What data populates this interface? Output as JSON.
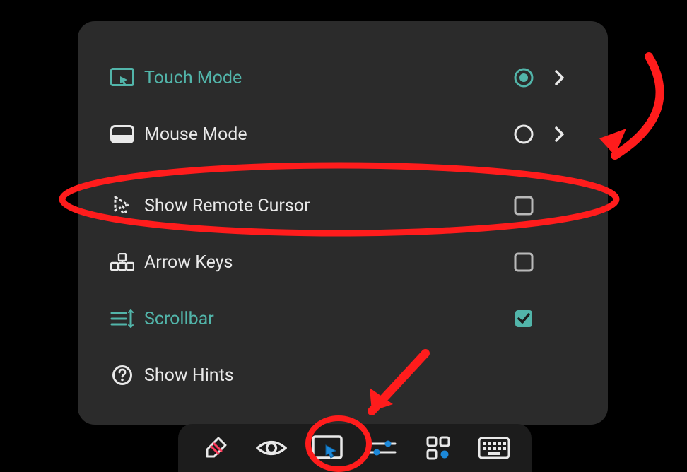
{
  "colors": {
    "accent": "#52b5aa",
    "panel": "#2b2b2b",
    "toolbar": "#1c1c1c",
    "fg": "#e9e9e9",
    "annotation": "#ff1c1c"
  },
  "menu": {
    "touch_mode": {
      "label": "Touch Mode",
      "selected": true,
      "has_chevron": true
    },
    "mouse_mode": {
      "label": "Mouse Mode",
      "selected": false,
      "has_chevron": true
    },
    "show_remote_cursor": {
      "label": "Show Remote Cursor",
      "checked": false
    },
    "arrow_keys": {
      "label": "Arrow Keys",
      "checked": false
    },
    "scrollbar": {
      "label": "Scrollbar",
      "checked": true
    },
    "show_hints": {
      "label": "Show Hints"
    }
  },
  "toolbar": {
    "items": [
      {
        "name": "eraser"
      },
      {
        "name": "eye"
      },
      {
        "name": "pointer-mode",
        "active": true
      },
      {
        "name": "sliders"
      },
      {
        "name": "apps"
      },
      {
        "name": "keyboard"
      }
    ]
  },
  "annotations": {
    "highlight_row": "show_remote_cursor",
    "highlight_toolbar": "pointer-mode"
  }
}
